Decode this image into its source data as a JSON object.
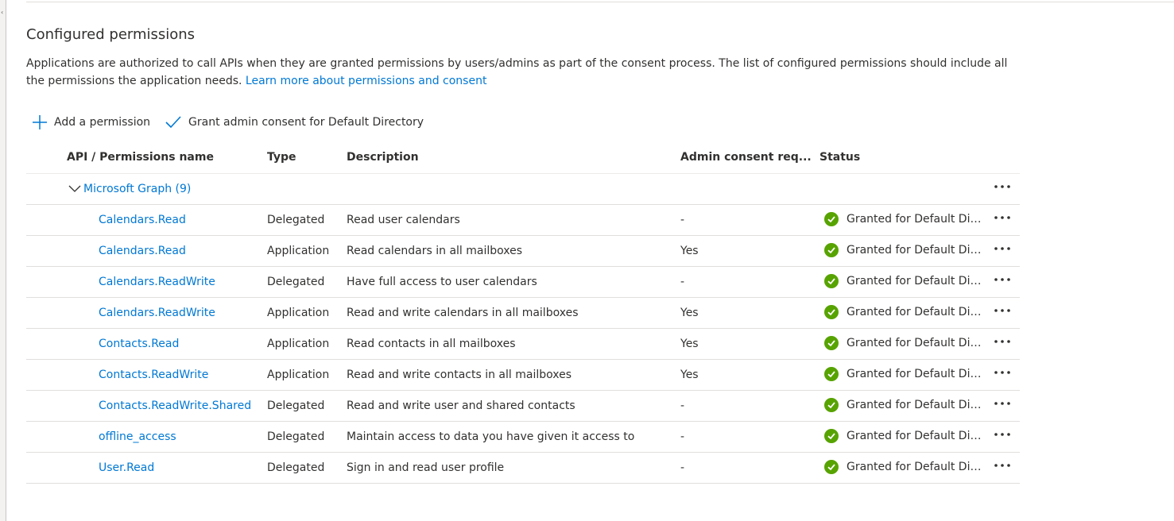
{
  "section": {
    "title": "Configured permissions",
    "intro": "Applications are authorized to call APIs when they are granted permissions by users/admins as part of the consent process. The list of configured permissions should include all the permissions the application needs.",
    "learn_more": "Learn more about permissions and consent"
  },
  "toolbar": {
    "add_label": "Add a permission",
    "grant_label": "Grant admin consent for Default Directory"
  },
  "table": {
    "headers": {
      "name": "API / Permissions name",
      "type": "Type",
      "description": "Description",
      "admin": "Admin consent req...",
      "status": "Status"
    },
    "group": {
      "label": "Microsoft Graph (9)"
    },
    "rows": [
      {
        "name": "Calendars.Read",
        "type": "Delegated",
        "description": "Read user calendars",
        "admin": "-",
        "status": "Granted for Default Directory"
      },
      {
        "name": "Calendars.Read",
        "type": "Application",
        "description": "Read calendars in all mailboxes",
        "admin": "Yes",
        "status": "Granted for Default Directory"
      },
      {
        "name": "Calendars.ReadWrite",
        "type": "Delegated",
        "description": "Have full access to user calendars",
        "admin": "-",
        "status": "Granted for Default Directory"
      },
      {
        "name": "Calendars.ReadWrite",
        "type": "Application",
        "description": "Read and write calendars in all mailboxes",
        "admin": "Yes",
        "status": "Granted for Default Directory"
      },
      {
        "name": "Contacts.Read",
        "type": "Application",
        "description": "Read contacts in all mailboxes",
        "admin": "Yes",
        "status": "Granted for Default Directory"
      },
      {
        "name": "Contacts.ReadWrite",
        "type": "Application",
        "description": "Read and write contacts in all mailboxes",
        "admin": "Yes",
        "status": "Granted for Default Directory"
      },
      {
        "name": "Contacts.ReadWrite.Shared",
        "type": "Delegated",
        "description": "Read and write user and shared contacts",
        "admin": "-",
        "status": "Granted for Default Directory"
      },
      {
        "name": "offline_access",
        "type": "Delegated",
        "description": "Maintain access to data you have given it access to",
        "admin": "-",
        "status": "Granted for Default Directory"
      },
      {
        "name": "User.Read",
        "type": "Delegated",
        "description": "Sign in and read user profile",
        "admin": "-",
        "status": "Granted for Default Directory"
      }
    ]
  },
  "colors": {
    "link": "#0078d4",
    "success": "#57a300",
    "text": "#323130"
  }
}
